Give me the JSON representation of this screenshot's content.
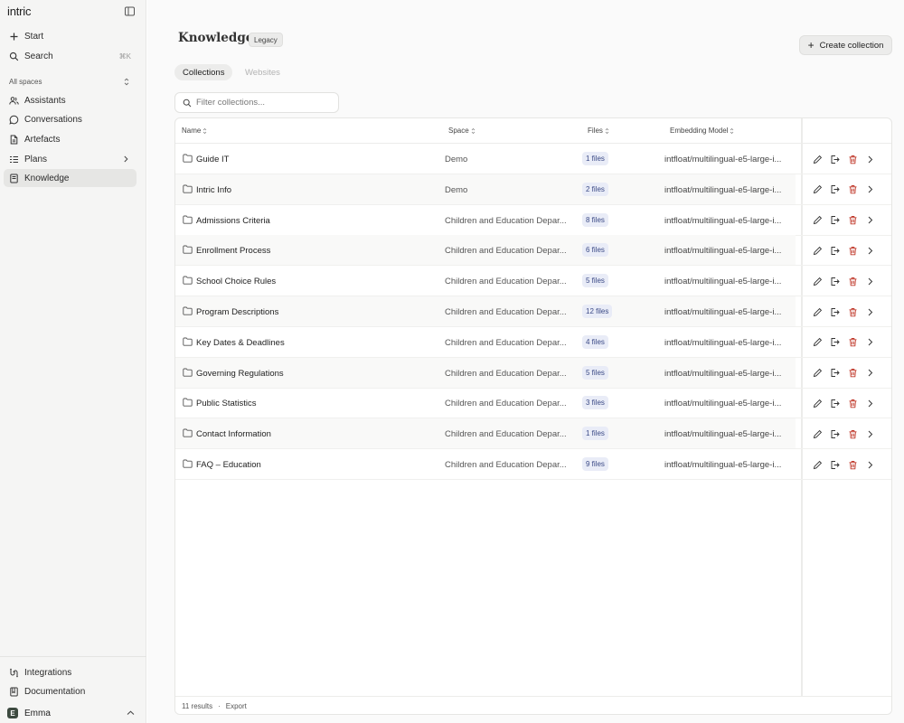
{
  "app": {
    "logo": "intric"
  },
  "sidebar": {
    "start_label": "Start",
    "search_label": "Search",
    "search_shortcut": "⌘K",
    "spaces_label": "All spaces",
    "items": [
      {
        "label": "Assistants",
        "icon": "users-icon"
      },
      {
        "label": "Conversations",
        "icon": "chat-icon"
      },
      {
        "label": "Artefacts",
        "icon": "file-icon"
      },
      {
        "label": "Plans",
        "icon": "list-icon"
      },
      {
        "label": "Knowledge",
        "icon": "book-icon",
        "active": true
      }
    ],
    "footer": {
      "integrations_label": "Integrations",
      "documentation_label": "Documentation",
      "user_initial": "E",
      "user_name": "Emma"
    }
  },
  "header": {
    "title": "Knowledge",
    "badge": "Legacy",
    "create_label": "Create collection"
  },
  "tabs": [
    {
      "label": "Collections",
      "active": true
    },
    {
      "label": "Websites",
      "active": false
    }
  ],
  "filter": {
    "placeholder": "Filter collections..."
  },
  "table": {
    "columns": [
      "Name",
      "Space",
      "Files",
      "Embedding Model"
    ],
    "rows": [
      {
        "name": "Guide IT",
        "space": "Demo",
        "files": "1 files",
        "model": "intfloat/multilingual-e5-large-i..."
      },
      {
        "name": "Intric Info",
        "space": "Demo",
        "files": "2 files",
        "model": "intfloat/multilingual-e5-large-i..."
      },
      {
        "name": "Admissions Criteria",
        "space": "Children and Education Depar...",
        "files": "8 files",
        "model": "intfloat/multilingual-e5-large-i..."
      },
      {
        "name": "Enrollment Process",
        "space": "Children and Education Depar...",
        "files": "6 files",
        "model": "intfloat/multilingual-e5-large-i..."
      },
      {
        "name": "School Choice Rules",
        "space": "Children and Education Depar...",
        "files": "5 files",
        "model": "intfloat/multilingual-e5-large-i..."
      },
      {
        "name": "Program Descriptions",
        "space": "Children and Education Depar...",
        "files": "12 files",
        "model": "intfloat/multilingual-e5-large-i..."
      },
      {
        "name": "Key Dates & Deadlines",
        "space": "Children and Education Depar...",
        "files": "4 files",
        "model": "intfloat/multilingual-e5-large-i..."
      },
      {
        "name": "Governing Regulations",
        "space": "Children and Education Depar...",
        "files": "5 files",
        "model": "intfloat/multilingual-e5-large-i..."
      },
      {
        "name": "Public Statistics",
        "space": "Children and Education Depar...",
        "files": "3 files",
        "model": "intfloat/multilingual-e5-large-i..."
      },
      {
        "name": "Contact Information",
        "space": "Children and Education Depar...",
        "files": "1 files",
        "model": "intfloat/multilingual-e5-large-i..."
      },
      {
        "name": "FAQ – Education",
        "space": "Children and Education Depar...",
        "files": "9 files",
        "model": "intfloat/multilingual-e5-large-i..."
      }
    ],
    "row_actions": [
      "edit-icon",
      "export-icon",
      "delete-icon",
      "chevron-right-icon"
    ],
    "footer": {
      "results": "11 results",
      "separator": "·",
      "export_label": "Export"
    }
  },
  "colors": {
    "files_badge_bg": "#e9ecf7",
    "files_badge_text": "#3b4a86",
    "sidebar_bg": "#f5f5f4",
    "user_avatar": "#3d4a40"
  }
}
